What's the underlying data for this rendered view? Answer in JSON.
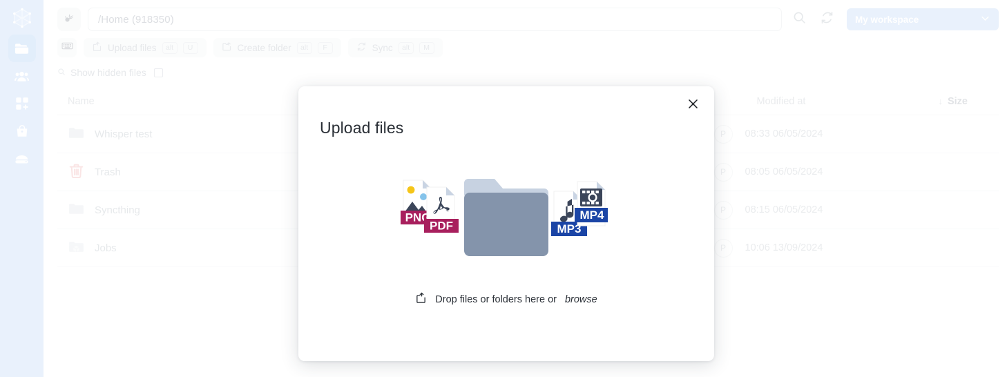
{
  "sidebar": {
    "items": [
      {
        "name": "logo",
        "icon": "network-logo-icon",
        "label": "Logo"
      },
      {
        "name": "files",
        "icon": "folder-icon",
        "label": "Files"
      },
      {
        "name": "users",
        "icon": "users-icon",
        "label": "Users"
      },
      {
        "name": "apps",
        "icon": "apps-add-icon",
        "label": "Apps"
      },
      {
        "name": "store",
        "icon": "bag-icon",
        "label": "Store"
      },
      {
        "name": "server",
        "icon": "server-icon",
        "label": "Server"
      }
    ],
    "active_index": 1,
    "background": "#bfd8f7"
  },
  "topbar": {
    "leaf_icon": "olive-branch-icon",
    "path_value": "/Home (918350)",
    "path_placeholder": "/Home",
    "search_icon": "search-icon",
    "refresh_icon": "refresh-icon",
    "workspace_label": "My workspace",
    "workspace_chevron": "chevron-down-icon",
    "workspace_color": "#bfd8f7"
  },
  "toolbar": {
    "keyboard_icon": "keyboard-icon",
    "buttons": [
      {
        "label": "Upload files",
        "icon": "upload-icon",
        "keys": [
          "alt",
          "U"
        ]
      },
      {
        "label": "Create folder",
        "icon": "folder-plus-icon",
        "keys": [
          "alt",
          "F"
        ]
      },
      {
        "label": "Sync",
        "icon": "sync-icon",
        "keys": [
          "alt",
          "M"
        ]
      }
    ],
    "hidden_files_label": "Show hidden files",
    "hidden_files_checked": false,
    "hidden_files_icon": "search-small-icon"
  },
  "table": {
    "columns": {
      "name": "Name",
      "modified": "Modified at",
      "size": "Size"
    },
    "sort": {
      "column": "Size",
      "direction": "desc",
      "arrow": "↓"
    },
    "rows": [
      {
        "name": "Whisper test",
        "icon": "folder-icon",
        "avatar": "P",
        "modified": "08:33 06/05/2024",
        "size": ""
      },
      {
        "name": "Trash",
        "icon": "trash-icon",
        "avatar": "P",
        "modified": "08:05 06/05/2024",
        "size": ""
      },
      {
        "name": "Syncthing",
        "icon": "folder-icon",
        "avatar": "P",
        "modified": "08:15 06/05/2024",
        "size": ""
      },
      {
        "name": "Jobs",
        "icon": "folder-box-icon",
        "avatar": "P",
        "modified": "10:06 13/09/2024",
        "size": ""
      }
    ]
  },
  "modal": {
    "title": "Upload files",
    "close_icon": "close-icon",
    "drop_icon": "upload-icon",
    "drop_text_prefix": "Drop files or folders here or",
    "drop_text_link": "browse",
    "illustration": {
      "cards": [
        {
          "label": "PNG",
          "badge_color": "#a81f5d",
          "kind": "image"
        },
        {
          "label": "PDF",
          "badge_color": "#a81f5d",
          "kind": "pdf"
        },
        {
          "label": "MP3",
          "badge_color": "#1b45a6",
          "kind": "audio"
        },
        {
          "label": "MP4",
          "badge_color": "#1b45a6",
          "kind": "video"
        }
      ],
      "folder_back_color": "#c7d2e1",
      "folder_front_color": "#8494ab"
    }
  }
}
